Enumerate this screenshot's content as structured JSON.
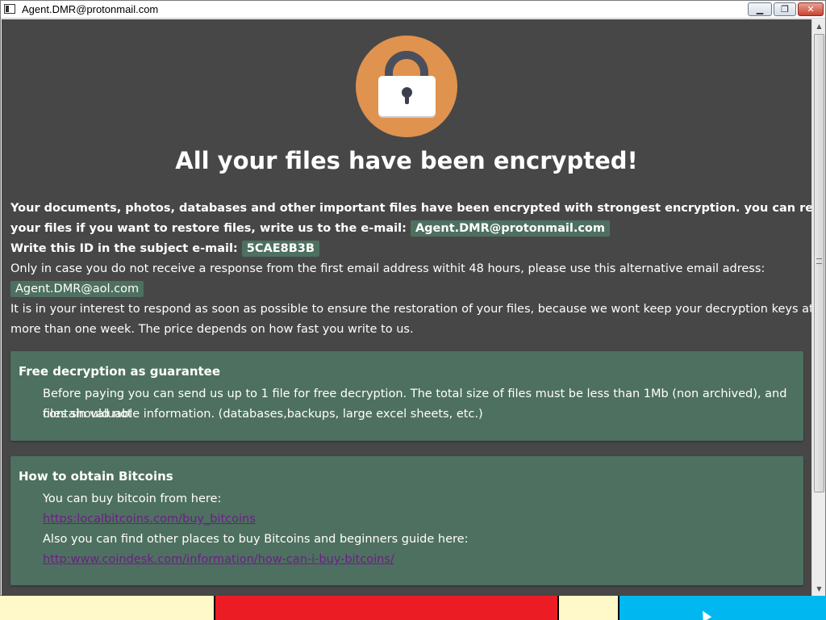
{
  "window": {
    "title": "Agent.DMR@protonmail.com",
    "icon": "app-window-icon",
    "controls": {
      "minimize": "▁",
      "maximize": "❐",
      "close": "✕"
    }
  },
  "header": {
    "lock_icon": "padlock-icon",
    "lock_circle_color": "#e0924f",
    "headline": "All your files have been encrypted!"
  },
  "intro": {
    "line1": "Your documents, photos, databases and other important files have been encrypted with strongest encryption. you can return all",
    "line2_prefix": "your files if you want to restore files, write us to the e-mail:",
    "email_primary": "Agent.DMR@protonmail.com",
    "id_prefix": "Write this ID in the subject e-mail:",
    "id_value": "5CAE8B3B",
    "alt_notice": "Only in case you do not receive a response from the first email address withit 48 hours, please use this alternative email adress:",
    "email_alt": "Agent.DMR@aol.com",
    "interest_line1": "It is in your interest to respond as soon as possible to ensure the restoration of your files, because we wont keep your decryption keys at our server",
    "interest_line2": "more than one week. The price depends on how fast you write to us."
  },
  "guarantee_box": {
    "title": "Free decryption as guarantee",
    "line1": "Before paying you can send us up to 1 file for free decryption. The total size of files must be less than 1Mb (non archived), and files should not",
    "line2": "contain valuable information. (databases,backups, large excel sheets, etc.)"
  },
  "bitcoin_box": {
    "title": "How to obtain Bitcoins",
    "line1": "You can buy bitcoin from here:",
    "link1": "https:localbitcoins.com/buy_bitcoins",
    "line2": "Also you can find other places to buy Bitcoins and beginners guide here:",
    "link2": "http:www.coindesk.com/information/how-can-i-buy-bitcoins/"
  },
  "colors": {
    "background": "#474747",
    "highlight": "#4e7060",
    "link": "#6b1f86"
  }
}
